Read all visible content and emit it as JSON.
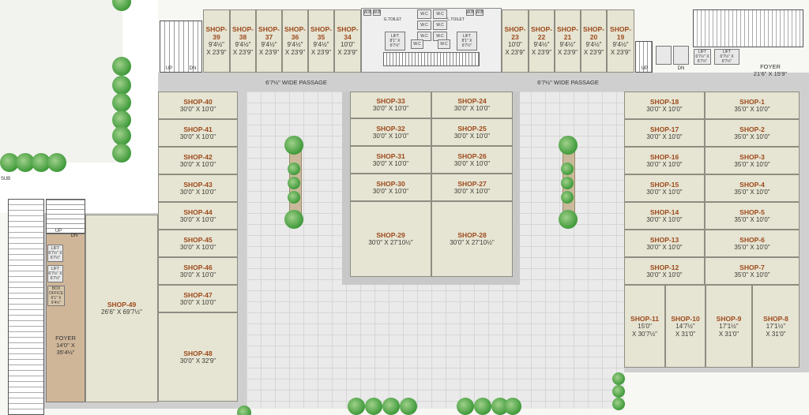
{
  "shops": [
    {
      "id": "shop-39",
      "name": "SHOP-39",
      "dim": "9'4½\"\nX 23'9\""
    },
    {
      "id": "shop-38",
      "name": "SHOP-38",
      "dim": "9'4½\"\nX 23'9\""
    },
    {
      "id": "shop-37",
      "name": "SHOP-37",
      "dim": "9'4½\"\nX 23'9\""
    },
    {
      "id": "shop-36",
      "name": "SHOP-36",
      "dim": "9'4½\"\nX 23'9\""
    },
    {
      "id": "shop-35",
      "name": "SHOP-35",
      "dim": "9'4½\"\nX 23'9\""
    },
    {
      "id": "shop-34",
      "name": "SHOP-34",
      "dim": "10'0\"\nX 23'9\""
    },
    {
      "id": "shop-23",
      "name": "SHOP-23",
      "dim": "10'0\"\nX 23'9\""
    },
    {
      "id": "shop-22",
      "name": "SHOP-22",
      "dim": "9'4½\"\nX 23'9\""
    },
    {
      "id": "shop-21",
      "name": "SHOP-21",
      "dim": "9'4½\"\nX 23'9\""
    },
    {
      "id": "shop-20",
      "name": "SHOP-20",
      "dim": "9'4½\"\nX 23'9\""
    },
    {
      "id": "shop-19",
      "name": "SHOP-19",
      "dim": "9'4½\"\nX 23'9\""
    },
    {
      "id": "shop-40",
      "name": "SHOP-40",
      "dim": "30'0\" X 10'0\""
    },
    {
      "id": "shop-41",
      "name": "SHOP-41",
      "dim": "30'0\" X 10'0\""
    },
    {
      "id": "shop-42",
      "name": "SHOP-42",
      "dim": "30'0\" X 10'0\""
    },
    {
      "id": "shop-43",
      "name": "SHOP-43",
      "dim": "30'0\" X 10'0\""
    },
    {
      "id": "shop-44",
      "name": "SHOP-44",
      "dim": "30'0\" X 10'0\""
    },
    {
      "id": "shop-45",
      "name": "SHOP-45",
      "dim": "30'0\" X 10'0\""
    },
    {
      "id": "shop-46",
      "name": "SHOP-46",
      "dim": "30'0\" X 10'0\""
    },
    {
      "id": "shop-47",
      "name": "SHOP-47",
      "dim": "30'0\" X 10'0\""
    },
    {
      "id": "shop-48",
      "name": "SHOP-48",
      "dim": "30'0\" X 32'9\""
    },
    {
      "id": "shop-49",
      "name": "SHOP-49",
      "dim": "26'6\" X 69'7½\""
    },
    {
      "id": "shop-33",
      "name": "SHOP-33",
      "dim": "30'0\" X 10'0\""
    },
    {
      "id": "shop-24",
      "name": "SHOP-24",
      "dim": "30'0\" X 10'0\""
    },
    {
      "id": "shop-32",
      "name": "SHOP-32",
      "dim": "30'0\" X 10'0\""
    },
    {
      "id": "shop-25",
      "name": "SHOP-25",
      "dim": "30'0\" X 10'0\""
    },
    {
      "id": "shop-31",
      "name": "SHOP-31",
      "dim": "30'0\" X 10'0\""
    },
    {
      "id": "shop-26",
      "name": "SHOP-26",
      "dim": "30'0\" X 10'0\""
    },
    {
      "id": "shop-30",
      "name": "SHOP-30",
      "dim": "30'0\" X 10'0\""
    },
    {
      "id": "shop-27",
      "name": "SHOP-27",
      "dim": "30'0\" X 10'0\""
    },
    {
      "id": "shop-29",
      "name": "SHOP-29",
      "dim": "30'0\" X 27'10½\""
    },
    {
      "id": "shop-28",
      "name": "SHOP-28",
      "dim": "30'0\" X 27'10½\""
    },
    {
      "id": "shop-18",
      "name": "SHOP-18",
      "dim": "30'0\" X 10'0\""
    },
    {
      "id": "shop-1",
      "name": "SHOP-1",
      "dim": "35'0\" X 10'0\""
    },
    {
      "id": "shop-17",
      "name": "SHOP-17",
      "dim": "30'0\" X 10'0\""
    },
    {
      "id": "shop-2",
      "name": "SHOP-2",
      "dim": "35'0\" X 10'0\""
    },
    {
      "id": "shop-16",
      "name": "SHOP-16",
      "dim": "30'0\" X 10'0\""
    },
    {
      "id": "shop-3",
      "name": "SHOP-3",
      "dim": "35'0\" X 10'0\""
    },
    {
      "id": "shop-15",
      "name": "SHOP-15",
      "dim": "30'0\" X 10'0\""
    },
    {
      "id": "shop-4",
      "name": "SHOP-4",
      "dim": "35'0\" X 10'0\""
    },
    {
      "id": "shop-14",
      "name": "SHOP-14",
      "dim": "30'0\" X 10'0\""
    },
    {
      "id": "shop-5",
      "name": "SHOP-5",
      "dim": "35'0\" X 10'0\""
    },
    {
      "id": "shop-13",
      "name": "SHOP-13",
      "dim": "30'0\" X 10'0\""
    },
    {
      "id": "shop-6",
      "name": "SHOP-6",
      "dim": "35'0\" X 10'0\""
    },
    {
      "id": "shop-12",
      "name": "SHOP-12",
      "dim": "30'0\" X 10'0\""
    },
    {
      "id": "shop-7",
      "name": "SHOP-7",
      "dim": "35'0\" X 10'0\""
    },
    {
      "id": "shop-11",
      "name": "SHOP-11",
      "dim": "15'0\"\nX 30'7½\""
    },
    {
      "id": "shop-10",
      "name": "SHOP-10",
      "dim": "14'7½\"\nX 31'0\""
    },
    {
      "id": "shop-9",
      "name": "SHOP-9",
      "dim": "17'1½\"\nX 31'0\""
    },
    {
      "id": "shop-8",
      "name": "SHOP-8",
      "dim": "17'1½\"\nX 31'0\""
    }
  ],
  "labels": {
    "passage_left": "6'7½\" WIDE PASSAGE",
    "passage_right": "6'7½\" WIDE PASSAGE",
    "foyer_right": "FOYER\n21'6\" X 15'9\"",
    "foyer_left": "FOYER\n14'0\" X\n35'4½\"",
    "sub": "SUB",
    "up_left": "UP",
    "dn_left": "DN",
    "up_right": "UP",
    "dn_right": "DN",
    "up_west": "UP",
    "dn_west": "DN",
    "g_toilet": "G.TOILET",
    "l_toilet": "L.TOILET",
    "lift_center_left": "LIFT\n8'1\" X\n6'7½\"",
    "lift_center_right": "LIFT\n8'1\" X\n6'7½\"",
    "lift_right_1": "LIFT\n6'7½\" X\n6'7½\"",
    "lift_right_2": "LIFT\n6'7½\" X 6'7½\"",
    "lift_west_1": "LIFT\n6'7½\" X\n6'7½\"",
    "lift_west_2": "LIFT\n6'7½\" X\n6'7½\"",
    "box_office": "BOX\nOFFICE\n6'1\" X\n9'4½\"",
    "wc": "W.C",
    "wb": "W.B"
  }
}
